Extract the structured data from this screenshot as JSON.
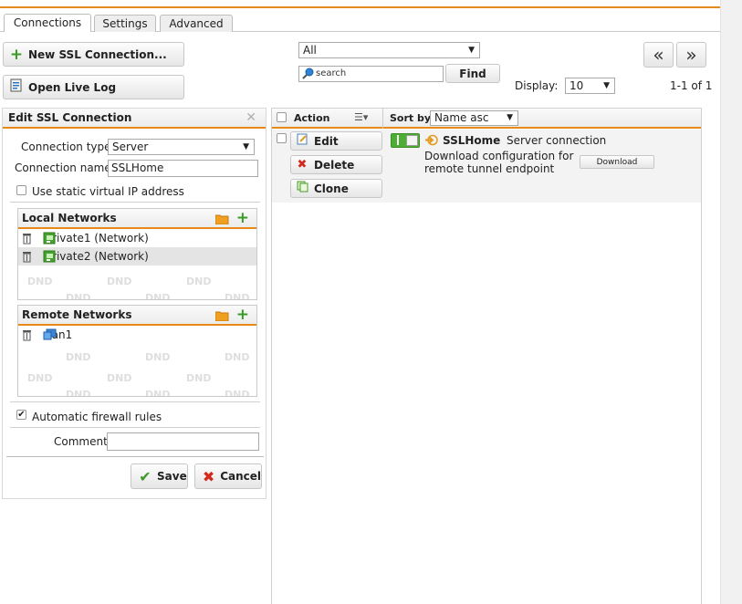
{
  "tabs": [
    {
      "label": "Connections",
      "active": true
    },
    {
      "label": "Settings",
      "active": false
    },
    {
      "label": "Advanced",
      "active": false
    }
  ],
  "toolbar": {
    "new_connection_label": "New SSL Connection...",
    "open_live_log_label": "Open Live Log",
    "filter_value": "All",
    "search_placeholder": "search",
    "find_label": "Find",
    "display_label": "Display:",
    "display_value": "10",
    "pagination": "1-1 of 1",
    "prev_label": "«",
    "next_label": "»"
  },
  "edit_panel": {
    "title": "Edit SSL Connection",
    "connection_type_label": "Connection type:",
    "connection_type_value": "Server",
    "connection_name_label": "Connection name:",
    "connection_name_value": "SSLHome",
    "static_ip_label": "Use static virtual IP address",
    "static_ip_checked": false,
    "local_networks": {
      "title": "Local Networks",
      "items": [
        {
          "label": "Private1 (Network)",
          "selected": false
        },
        {
          "label": "Private2 (Network)",
          "selected": true
        }
      ]
    },
    "remote_networks": {
      "title": "Remote Networks",
      "items": [
        {
          "label": "Lan1",
          "selected": false
        }
      ]
    },
    "dnd_label": "DND",
    "firewall_label": "Automatic firewall rules",
    "firewall_checked": true,
    "comment_label": "Comment:",
    "comment_value": "",
    "save_label": "Save",
    "cancel_label": "Cancel"
  },
  "list": {
    "action_header": "Action",
    "sort_by_label": "Sort by:",
    "sort_value": "Name asc",
    "row": {
      "edit_label": "Edit",
      "delete_label": "Delete",
      "clone_label": "Clone",
      "name": "SSLHome",
      "type": "Server connection",
      "description_line1": "Download configuration for",
      "description_line2": "remote tunnel endpoint",
      "download_label": "Download",
      "enabled": true
    }
  },
  "colors": {
    "accent": "#e8891a",
    "toggle_on": "#4cae32",
    "add_green": "#3a9a26",
    "delete_red": "#d22b1e"
  }
}
